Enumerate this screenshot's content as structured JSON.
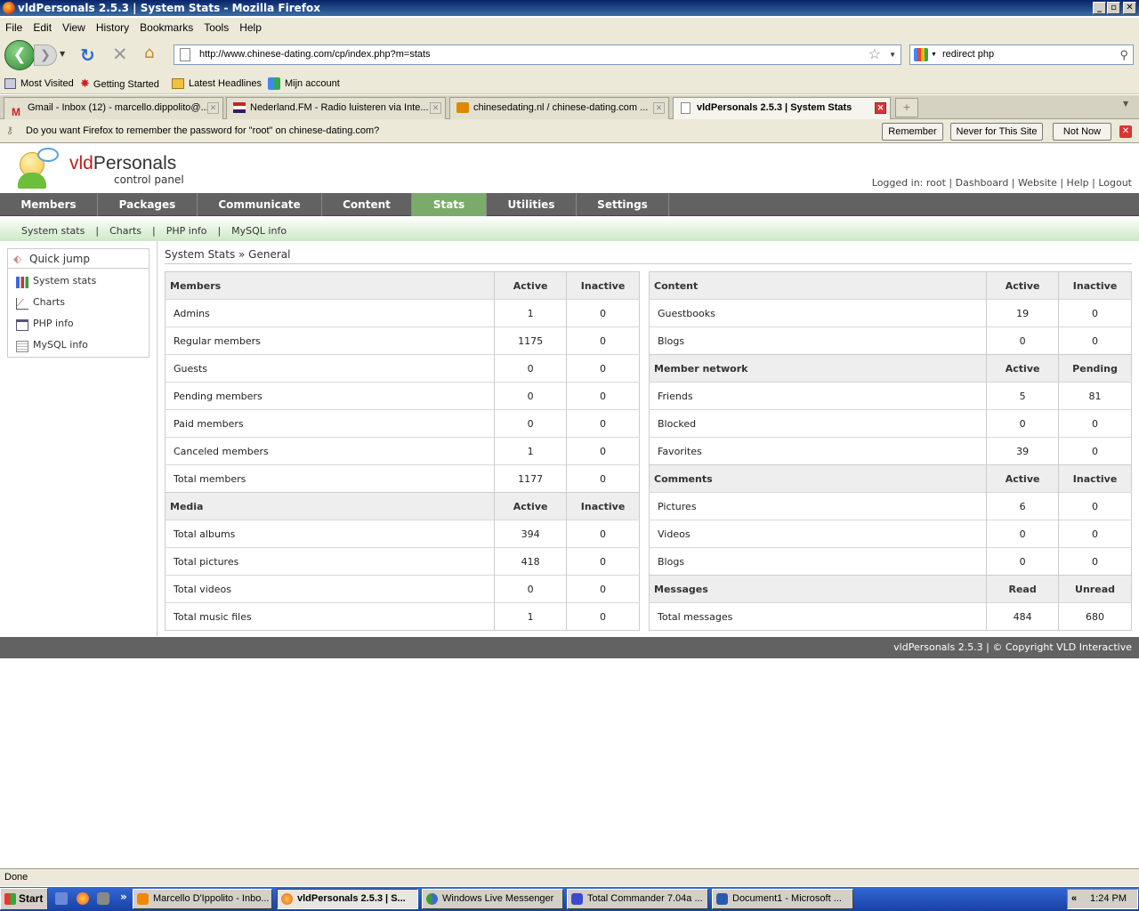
{
  "window": {
    "title": "vldPersonals 2.5.3 | System Stats - Mozilla Firefox",
    "min": "_",
    "max": "▫",
    "close": "✕"
  },
  "menu": [
    "File",
    "Edit",
    "View",
    "History",
    "Bookmarks",
    "Tools",
    "Help"
  ],
  "toolbar": {
    "url": "http://www.chinese-dating.com/cp/index.php?m=stats",
    "search": "redirect php"
  },
  "bookmarks": [
    "Most Visited",
    "Getting Started",
    "Latest Headlines",
    "Mijn account"
  ],
  "tabs": [
    {
      "label": "Gmail - Inbox (12) - marcello.dippolito@...",
      "icon": "gmail-icon"
    },
    {
      "label": "Nederland.FM - Radio luisteren via Inte...",
      "icon": "radio-icon"
    },
    {
      "label": "chinesedating.nl / chinese-dating.com ...",
      "icon": "site-icon"
    },
    {
      "label": "vldPersonals 2.5.3 | System Stats",
      "icon": "page-icon"
    }
  ],
  "password_bar": {
    "message": "Do you want Firefox to remember the password for \"root\" on chinese-dating.com?",
    "remember": "Remember",
    "never": "Never for This Site",
    "not_now": "Not Now"
  },
  "header": {
    "brand_red": "vld",
    "brand_rest": "Personals",
    "subtitle": "control panel",
    "links": "Logged in: root | Dashboard | Website | Help | Logout"
  },
  "nav": [
    "Members",
    "Packages",
    "Communicate",
    "Content",
    "Stats",
    "Utilities",
    "Settings"
  ],
  "subnav": [
    "System stats",
    "Charts",
    "PHP info",
    "MySQL info"
  ],
  "sidebar": [
    "Quick jump",
    "System stats",
    "Charts",
    "PHP info",
    "MySQL info"
  ],
  "breadcrumb": "System Stats » General",
  "left_table": {
    "members": {
      "header": [
        "Members",
        "Active",
        "Inactive"
      ],
      "rows": [
        [
          "Admins",
          "1",
          "0"
        ],
        [
          "Regular members",
          "1175",
          "0"
        ],
        [
          "Guests",
          "0",
          "0"
        ],
        [
          "Pending members",
          "0",
          "0"
        ],
        [
          "Paid members",
          "0",
          "0"
        ],
        [
          "Canceled members",
          "1",
          "0"
        ],
        [
          "Total members",
          "1177",
          "0"
        ]
      ]
    },
    "media": {
      "header": [
        "Media",
        "Active",
        "Inactive"
      ],
      "rows": [
        [
          "Total albums",
          "394",
          "0"
        ],
        [
          "Total pictures",
          "418",
          "0"
        ],
        [
          "Total videos",
          "0",
          "0"
        ],
        [
          "Total music files",
          "1",
          "0"
        ]
      ]
    }
  },
  "right_table": {
    "content": {
      "header": [
        "Content",
        "Active",
        "Inactive"
      ],
      "rows": [
        [
          "Guestbooks",
          "19",
          "0"
        ],
        [
          "Blogs",
          "0",
          "0"
        ]
      ]
    },
    "network": {
      "header": [
        "Member network",
        "Active",
        "Pending"
      ],
      "rows": [
        [
          "Friends",
          "5",
          "81"
        ],
        [
          "Blocked",
          "0",
          "0"
        ],
        [
          "Favorites",
          "39",
          "0"
        ]
      ]
    },
    "comments": {
      "header": [
        "Comments",
        "Active",
        "Inactive"
      ],
      "rows": [
        [
          "Pictures",
          "6",
          "0"
        ],
        [
          "Videos",
          "0",
          "0"
        ],
        [
          "Blogs",
          "0",
          "0"
        ]
      ]
    },
    "messages": {
      "header": [
        "Messages",
        "Read",
        "Unread"
      ],
      "rows": [
        [
          "Total messages",
          "484",
          "680"
        ]
      ]
    }
  },
  "footer": "vldPersonals 2.5.3 | © Copyright VLD Interactive",
  "status": "Done",
  "taskbar": {
    "start": "Start",
    "items": [
      "Marcello D'Ippolito - Inbo...",
      "vldPersonals 2.5.3 | S...",
      "Windows Live Messenger",
      "Total Commander 7.04a ...",
      "Document1 - Microsoft ..."
    ],
    "clock": "1:24 PM",
    "tray_arrow": "«"
  }
}
